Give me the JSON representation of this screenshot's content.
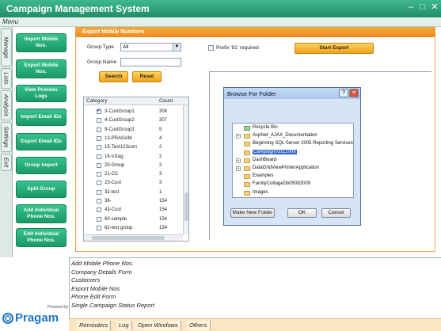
{
  "app": {
    "title": "Campaign Management System"
  },
  "window_buttons": {
    "minimize": "–",
    "maximize": "□",
    "close": "✕"
  },
  "menu_label": "Menu",
  "left_tabs": [
    "Manage",
    "Lists",
    "Analysis",
    "Settings",
    "Exit"
  ],
  "side_buttons": [
    "Import Mobile Nos.",
    "Export Mobile Nos.",
    "View Process Logs",
    "Import Email IDs",
    "Export Email IDs",
    "Group Import",
    "Split Group",
    "Add Individual Phone Nos.",
    "Edit Individual Phone Nos."
  ],
  "panel": {
    "title": "Export Mobile Numbers",
    "group_type_label": "Group Type",
    "group_type_value": "All",
    "group_name_label": "Group Name",
    "group_name_value": "",
    "search_label": "Search",
    "reset_label": "Reset",
    "prefix_label": "Prefix '91' required",
    "start_export_label": "Start Export"
  },
  "grid": {
    "headers": {
      "category": "Category",
      "count": "Count"
    },
    "rows": [
      {
        "name": "3-CustGroup1",
        "count": "308",
        "checked": true
      },
      {
        "name": "4-CustGroup2",
        "count": "307",
        "checked": false
      },
      {
        "name": "9-CustGroup3",
        "count": "5",
        "checked": false
      },
      {
        "name": "13-PRAGAM",
        "count": "4",
        "checked": false
      },
      {
        "name": "15-Test123com",
        "count": "2",
        "checked": false
      },
      {
        "name": "16-Vizag",
        "count": "2",
        "checked": false
      },
      {
        "name": "20-Group",
        "count": "2",
        "checked": false
      },
      {
        "name": "21-CC",
        "count": "3",
        "checked": false
      },
      {
        "name": "23-Cust",
        "count": "3",
        "checked": false
      },
      {
        "name": "32-test",
        "count": "1",
        "checked": false
      },
      {
        "name": "38-",
        "count": "154",
        "checked": false
      },
      {
        "name": "43-Cust",
        "count": "154",
        "checked": false
      },
      {
        "name": "60-sample",
        "count": "154",
        "checked": false
      },
      {
        "name": "62-test group",
        "count": "154",
        "checked": false
      }
    ]
  },
  "dialog": {
    "title": "Browse For Folder",
    "help_btn": "?",
    "close_btn": "✕",
    "tree": [
      {
        "label": "Recycle Bin",
        "indent": 0,
        "expander": "",
        "recycle": true
      },
      {
        "label": "AspNet_AJAX_Documentation",
        "indent": 0,
        "expander": "+"
      },
      {
        "label": "Beginning SQL Server 2005 Reporting Services",
        "indent": 0,
        "expander": ""
      },
      {
        "label": "Campaign03112009",
        "indent": 0,
        "expander": "",
        "selected": true
      },
      {
        "label": "DashBoard",
        "indent": 0,
        "expander": "+"
      },
      {
        "label": "DataGridViewPrinterApplication",
        "indent": 0,
        "expander": "+"
      },
      {
        "label": "Examples",
        "indent": 0,
        "expander": ""
      },
      {
        "label": "FamilyCottageDb05082009",
        "indent": 0,
        "expander": ""
      },
      {
        "label": "Images",
        "indent": 0,
        "expander": ""
      }
    ],
    "make_new_folder": "Make New Folder",
    "ok": "OK",
    "cancel": "Cancel"
  },
  "log_lines": [
    "Add  Mobile Phone Nos.",
    "Company Details Form",
    "Customers",
    "Export Mobile Nos",
    "Phone Edit Form",
    "Single Campaign Status Report"
  ],
  "bottom_tabs": [
    "Reminders",
    "Log",
    "Open Windows",
    "Others"
  ],
  "logo": {
    "powered_by": "Powered by",
    "brand": "Pragam"
  }
}
